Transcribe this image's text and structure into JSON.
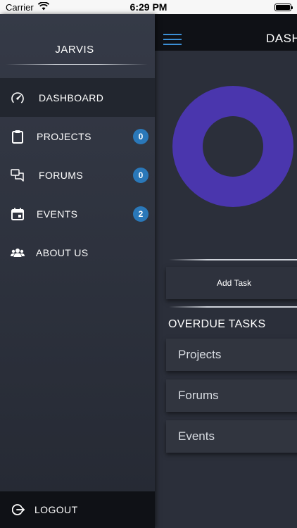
{
  "status_bar": {
    "carrier": "Carrier",
    "time": "6:29 PM"
  },
  "drawer": {
    "brand": "JARVIS",
    "items": [
      {
        "label": "DASHBOARD",
        "icon": "speedometer-icon",
        "active": true
      },
      {
        "label": "PROJECTS",
        "icon": "clipboard-icon",
        "badge": "0"
      },
      {
        "label": "FORUMS",
        "icon": "chat-bubbles-icon",
        "badge": "0"
      },
      {
        "label": "EVENTS",
        "icon": "calendar-icon",
        "badge": "2"
      },
      {
        "label": "ABOUT US",
        "icon": "group-icon"
      }
    ],
    "logout": "LOGOUT"
  },
  "main": {
    "title": "DASHBOARD",
    "add_task": "Add Task",
    "overdue_title": "OVERDUE TASKS",
    "tasks": [
      "Projects",
      "Forums",
      "Events"
    ]
  },
  "colors": {
    "accent": "#2a78b9",
    "donut": "#4a36ad",
    "drawer_top": "#353a47",
    "header": "#0f1116"
  }
}
